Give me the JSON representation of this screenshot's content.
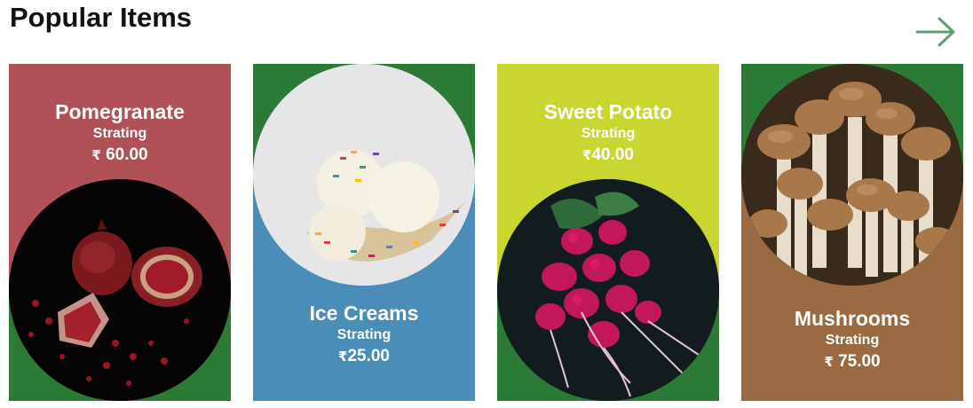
{
  "header": {
    "title": "Popular Items"
  },
  "nav": {
    "next_icon": "arrow-right-icon",
    "accent": "#5f9e6e"
  },
  "cards": [
    {
      "name": "Pomegranate",
      "subtitle": "Strating",
      "currency": "₹",
      "amount": " 60.00",
      "image": "pomegranate-image",
      "bg_top": "#b05158",
      "bg_bottom": "#2b7a36"
    },
    {
      "name": "Ice Creams",
      "subtitle": "Strating",
      "currency": "₹",
      "amount": "25.00",
      "image": "ice-cream-image",
      "bg_top": "#2b7a36",
      "bg_bottom": "#4b8db9"
    },
    {
      "name": "Sweet Potato",
      "subtitle": "Strating",
      "currency": "₹",
      "amount": "40.00",
      "image": "radish-image",
      "bg_top": "#c9d630",
      "bg_bottom": "#2b7a36"
    },
    {
      "name": "Mushrooms",
      "subtitle": "Strating",
      "currency": "₹",
      "amount": " 75.00",
      "image": "mushroom-image",
      "bg_top": "#2b7a36",
      "bg_bottom": "#9a6a43"
    }
  ]
}
